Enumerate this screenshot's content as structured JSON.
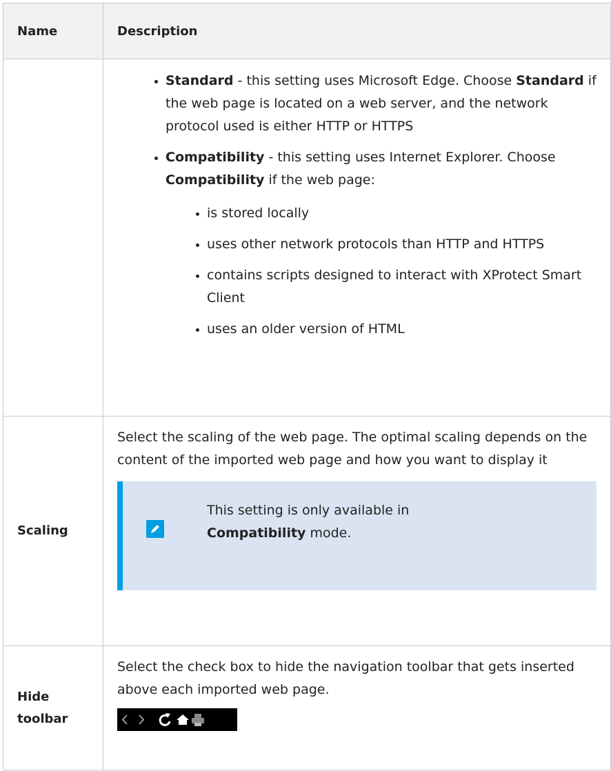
{
  "header": {
    "name": "Name",
    "description": "Description"
  },
  "row1": {
    "bullets": [
      {
        "bold": "Standard",
        "text": " - this setting uses Microsoft Edge. Choose ",
        "bold2": "Standard",
        "text2": " if the web page is located on a web server, and the network protocol used is either HTTP or HTTPS"
      },
      {
        "bold": "Compatibility",
        "text": " - this setting uses Internet Explorer. Choose ",
        "bold2": "Compatibility",
        "text2": " if the web page:"
      }
    ],
    "sub": [
      "is stored locally",
      "uses other network protocols than HTTP and HTTPS",
      "contains scripts designed to interact with XProtect Smart Client",
      "uses an older version of HTML"
    ]
  },
  "row2": {
    "name": "Scaling",
    "desc": "Select the scaling of the web page. The optimal scaling depends on the content of the imported web page and how you want to display it",
    "note_a": "This setting is only available in",
    "note_bold": "Compatibility",
    "note_b": " mode.",
    "note_icon": "pencil-icon"
  },
  "row3": {
    "name": "Hide toolbar",
    "desc": "Select the check box to hide the navigation toolbar that gets inserted above each imported web page.",
    "toolbar_icons": [
      "back-arrow-icon",
      "forward-arrow-icon",
      "refresh-icon",
      "home-icon",
      "print-icon"
    ]
  },
  "colors": {
    "note_bg": "#dae3f1",
    "note_accent": "#009ee3",
    "header_bg": "#f2f2f2"
  }
}
